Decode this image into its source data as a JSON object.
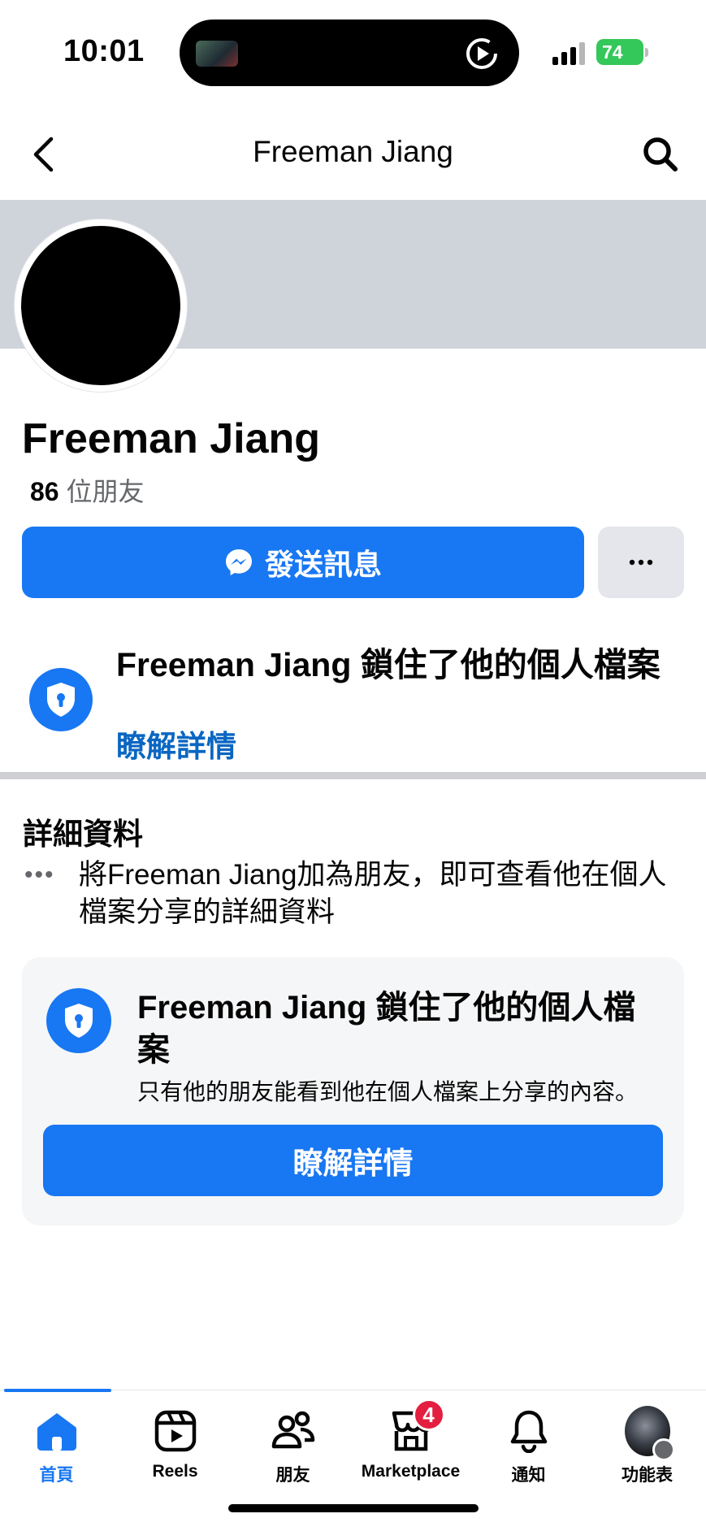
{
  "status_bar": {
    "time": "10:01",
    "battery": "74"
  },
  "header": {
    "title": "Freeman Jiang",
    "back_icon": "chevron-left-icon",
    "search_icon": "search-icon"
  },
  "profile": {
    "name": "Freeman Jiang",
    "friends_count": "86",
    "friends_label": "位朋友",
    "message_button": "發送訊息",
    "more_button": "···"
  },
  "lock_notice": {
    "title": "Freeman Jiang 鎖住了他的個人檔案",
    "link": "瞭解詳情"
  },
  "details": {
    "heading": "詳細資料",
    "dots": "•••",
    "text": "將Freeman Jiang加為朋友，即可查看他在個人檔案分享的詳細資料"
  },
  "lock_card": {
    "title": "Freeman Jiang 鎖住了他的個人檔案",
    "subtitle": "只有他的朋友能看到他在個人檔案上分享的內容。",
    "button": "瞭解詳情"
  },
  "bottom_nav": {
    "items": [
      {
        "label": "首頁",
        "icon": "home-icon",
        "active": true
      },
      {
        "label": "Reels",
        "icon": "reels-icon"
      },
      {
        "label": "朋友",
        "icon": "friends-icon"
      },
      {
        "label": "Marketplace",
        "icon": "marketplace-icon",
        "badge": "4"
      },
      {
        "label": "通知",
        "icon": "bell-icon"
      },
      {
        "label": "功能表",
        "icon": "menu-avatar-icon"
      }
    ]
  },
  "colors": {
    "accent": "#1877f2",
    "link": "#0a66c2",
    "badge": "#e41e3f",
    "cover": "#cfd3da"
  }
}
